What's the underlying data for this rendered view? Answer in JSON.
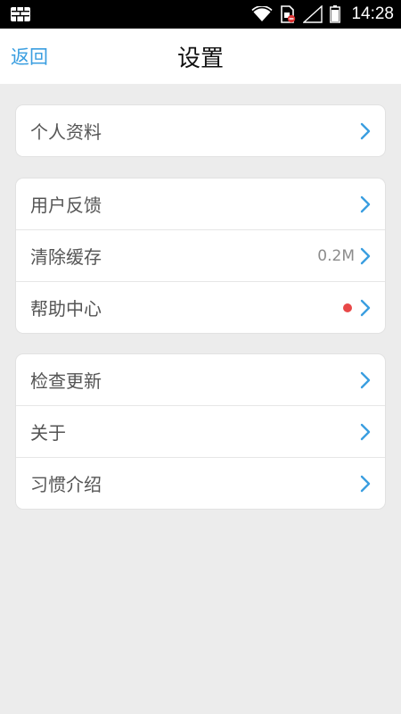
{
  "statusbar": {
    "time": "14:28",
    "icons": [
      "wall-app-icon",
      "wifi-icon",
      "sim-no-card-icon",
      "signal-icon",
      "battery-icon"
    ]
  },
  "header": {
    "back_label": "返回",
    "title": "设置"
  },
  "groups": [
    {
      "items": [
        {
          "label": "个人资料"
        }
      ]
    },
    {
      "items": [
        {
          "label": "用户反馈"
        },
        {
          "label": "清除缓存",
          "value": "0.2M"
        },
        {
          "label": "帮助中心",
          "badge": "red-dot"
        }
      ]
    },
    {
      "items": [
        {
          "label": "检查更新"
        },
        {
          "label": "关于"
        },
        {
          "label": "习惯介绍"
        }
      ]
    }
  ],
  "colors": {
    "accent": "#3a9ee0",
    "background": "#ececec",
    "badge": "#e84848"
  }
}
